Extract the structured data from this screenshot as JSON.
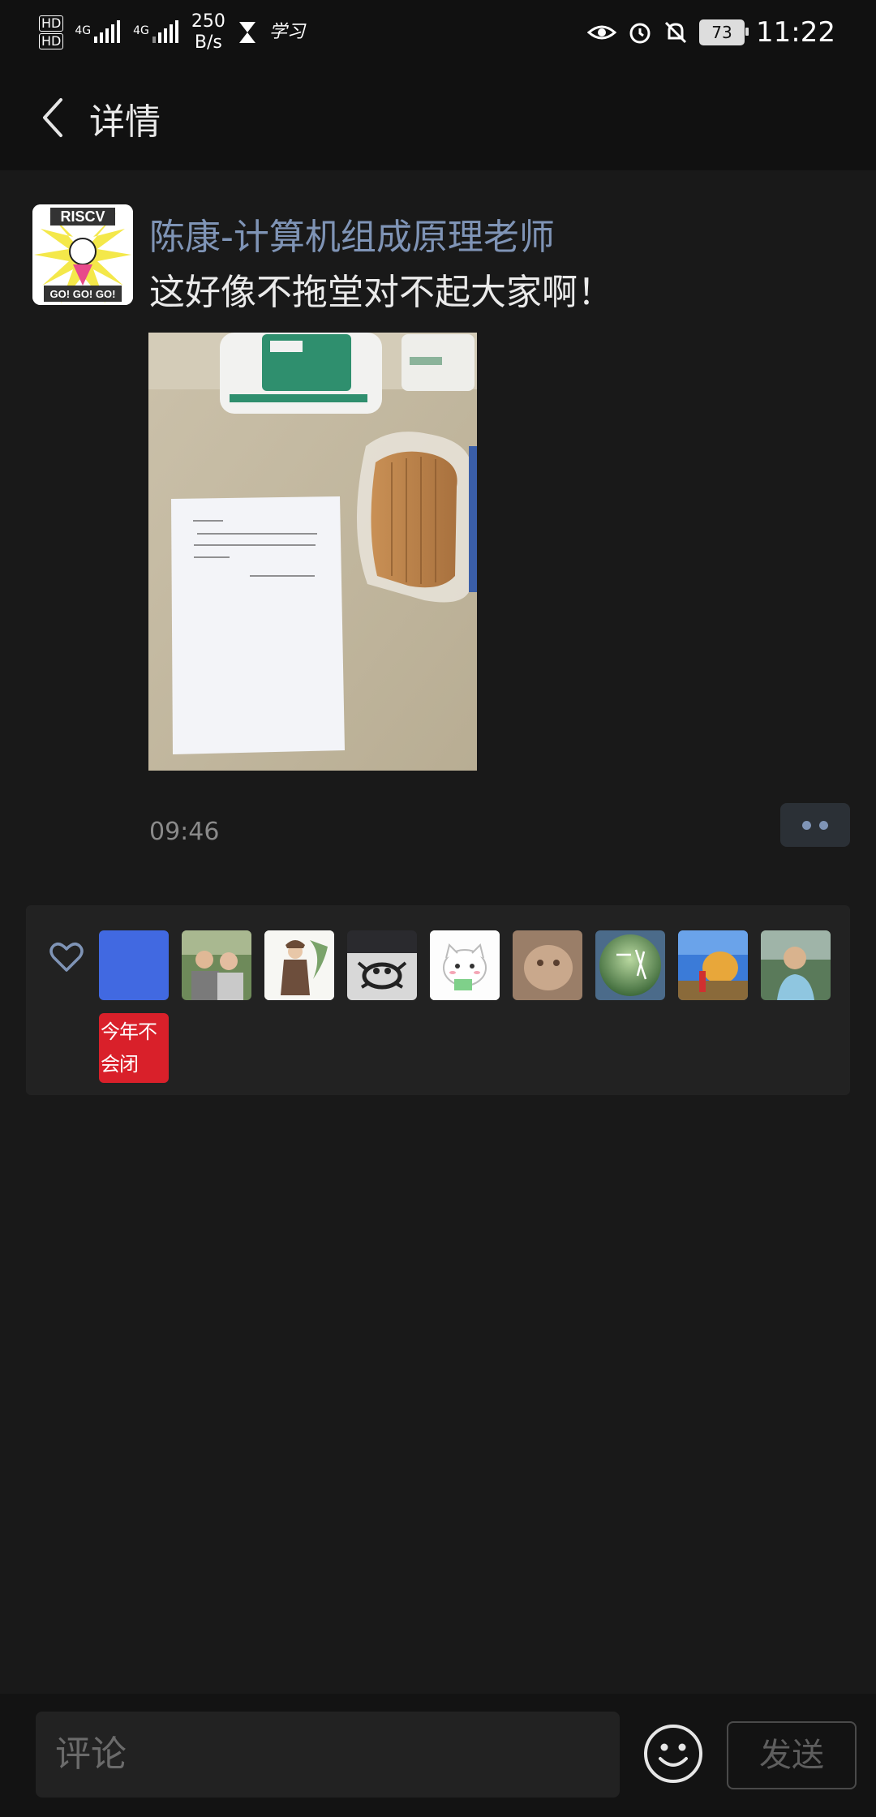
{
  "status_bar": {
    "hd1": "HD",
    "hd2": "HD",
    "net1": "4G",
    "net2": "4G",
    "speed_value": "250",
    "speed_unit": "B/s",
    "app_label": "学习",
    "battery": "73",
    "time": "11:22"
  },
  "header": {
    "title": "详情"
  },
  "post": {
    "author": "陈康-计算机组成原理老师",
    "text": "这好像不拖堂对不起大家啊！",
    "avatar_top_text": "RISCV",
    "avatar_bottom_text": "GO! GO! GO!",
    "time": "09:46"
  },
  "likes": {
    "last_avatar_text": "今年不会闭"
  },
  "comment_bar": {
    "placeholder": "评论",
    "send_label": "发送"
  },
  "colors": {
    "background": "#191919",
    "name_color": "#7f94b6",
    "like_panel": "#222222"
  }
}
